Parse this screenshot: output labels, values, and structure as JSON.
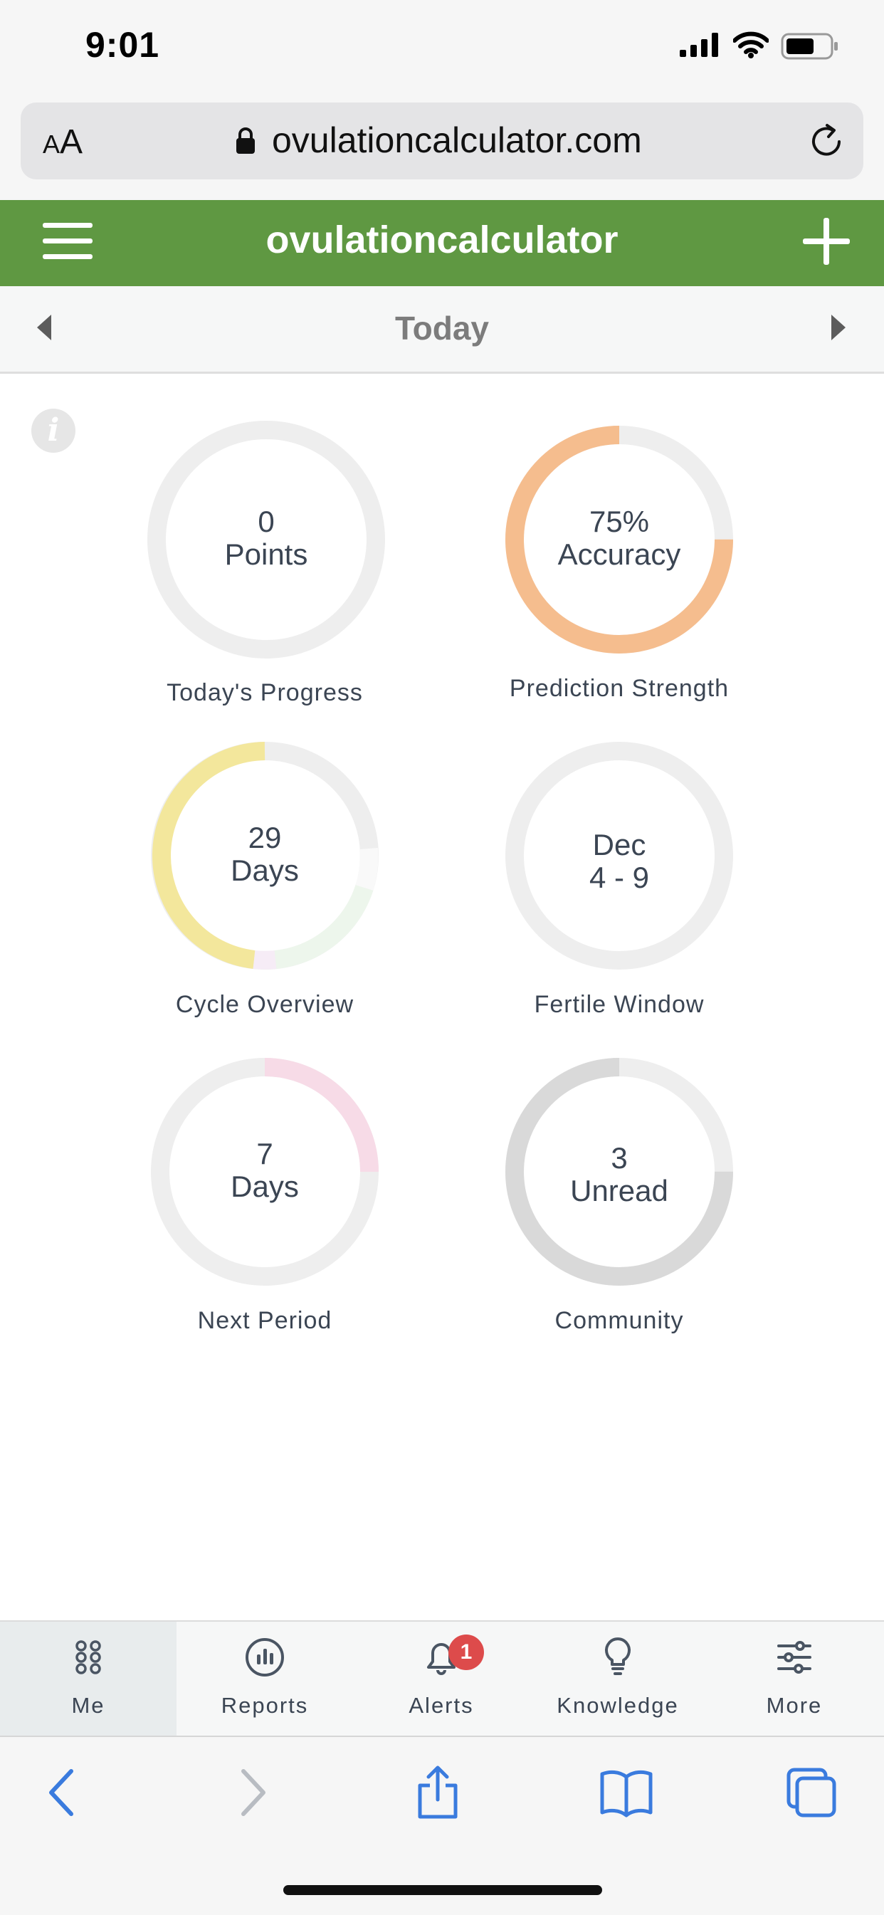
{
  "status_bar": {
    "time": "9:01"
  },
  "browser": {
    "text_size_label_small": "A",
    "text_size_label_large": "A",
    "url": "ovulationcalculator.com"
  },
  "header": {
    "title": "ovulationcalculator"
  },
  "date_nav": {
    "label": "Today"
  },
  "dashboard": {
    "rings": [
      {
        "line1": "0",
        "line2": "Points",
        "caption": "Today's Progress",
        "progress": 0
      },
      {
        "line1": "75%",
        "line2": "Accuracy",
        "caption": "Prediction Strength",
        "progress": 0.75,
        "color": "#f5bd8e"
      },
      {
        "line1": "29",
        "line2": "Days",
        "caption": "Cycle Overview",
        "color": "#f3e79c"
      },
      {
        "line1": "Dec",
        "line2": "4 - 9",
        "caption": "Fertile Window",
        "progress": 0
      },
      {
        "line1": "7",
        "line2": "Days",
        "caption": "Next Period",
        "progress": 0.25,
        "color": "#f7dbe7"
      },
      {
        "line1": "3",
        "line2": "Unread",
        "caption": "Community",
        "progress": 0.75,
        "color": "#d9d9d9"
      }
    ]
  },
  "tabs": [
    {
      "label": "Me",
      "icon": "grid-icon",
      "active": true
    },
    {
      "label": "Reports",
      "icon": "bar-chart-icon"
    },
    {
      "label": "Alerts",
      "icon": "bell-icon",
      "badge": "1"
    },
    {
      "label": "Knowledge",
      "icon": "lightbulb-icon"
    },
    {
      "label": "More",
      "icon": "sliders-icon"
    }
  ],
  "colors": {
    "header_green": "#5f9842",
    "ring_track": "#eeeeee",
    "accuracy_orange": "#f5bd8e",
    "cycle_yellow": "#f3e79c",
    "period_pink": "#f7dbe7",
    "community_gray": "#d9d9d9",
    "badge_red": "#dd4b4b",
    "toolbar_blue": "#3a7bde"
  }
}
